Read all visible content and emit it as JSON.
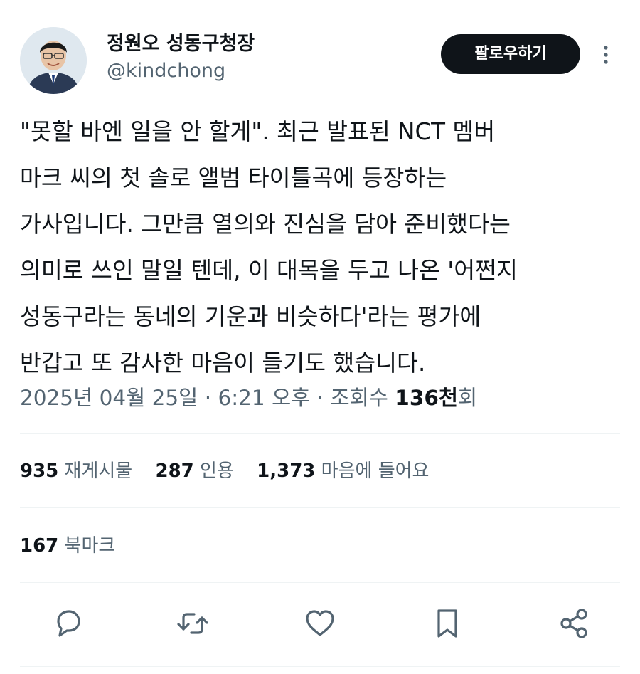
{
  "author": {
    "display_name": "정원오 성동구청장",
    "handle": "@kindchong"
  },
  "follow_button": {
    "label": "팔로우하기"
  },
  "post": {
    "text": "\"못할 바엔 일을 안 할게\". 최근 발표된 NCT 멤버\n마크 씨의 첫 솔로 앨범 타이틀곡에 등장하는\n가사입니다. 그만큼 열의와 진심을 담아 준비했다는\n의미로 쓰인 말일 텐데, 이 대목을 두고 나온 '어쩐지\n성동구라는 동네의 기운과 비슷하다'라는 평가에\n반갑고 또 감사한 마음이 들기도 했습니다."
  },
  "meta": {
    "datetime": "2025년 04월 25일 · 6:21 오후 · 조회수 ",
    "views_number": "136천",
    "views_unit": "회"
  },
  "stats": {
    "reposts_count": "935",
    "reposts_label": "재게시물",
    "quotes_count": "287",
    "quotes_label": "인용",
    "likes_count": "1,373",
    "likes_label": "마음에 들어요",
    "bookmarks_count": "167",
    "bookmarks_label": "북마크"
  },
  "icons": {
    "more": "more-vertical-icon",
    "reply": "reply-icon",
    "repost": "repost-icon",
    "like": "heart-icon",
    "bookmark": "bookmark-icon",
    "share": "share-icon"
  },
  "colors": {
    "text_primary": "#0f1419",
    "text_secondary": "#536471",
    "follow_button_bg": "#0f1419",
    "divider": "#eff3f4"
  }
}
